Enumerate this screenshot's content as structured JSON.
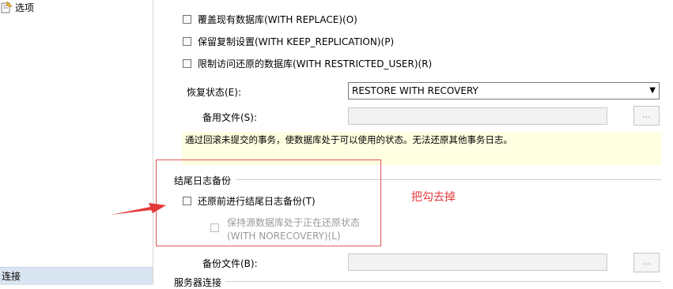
{
  "left_panel": {
    "item_label": "选项",
    "connection_label": "连接"
  },
  "options": {
    "overwrite": "覆盖现有数据库(WITH REPLACE)(O)",
    "keep_replication": "保留复制设置(WITH KEEP_REPLICATION)(P)",
    "restricted_user": "限制访问还原的数据库(WITH RESTRICTED_USER)(R)"
  },
  "recovery": {
    "state_label": "恢复状态(E):",
    "state_value": "RESTORE WITH RECOVERY",
    "standby_label": "备用文件(S):",
    "standby_browse": "...",
    "info_text": "通过回滚未提交的事务，使数据库处于可以使用的状态。无法还原其他事务日志。"
  },
  "tail_log": {
    "group_title": "结尾日志备份",
    "take_backup_label": "还原前进行结尾日志备份(T)",
    "norecovery_line1": "保持源数据库处于正在还原状态",
    "norecovery_line2": "(WITH NORECOVERY)(L)",
    "backup_file_label": "备份文件(B):",
    "backup_browse": "..."
  },
  "server_conn_label": "服务器连接",
  "annotation": {
    "text": "把勾去掉"
  },
  "colors": {
    "annotation_red": "#e33a3a",
    "info_bg": "#ffffe1",
    "connection_bar": "#d9e4f1"
  }
}
